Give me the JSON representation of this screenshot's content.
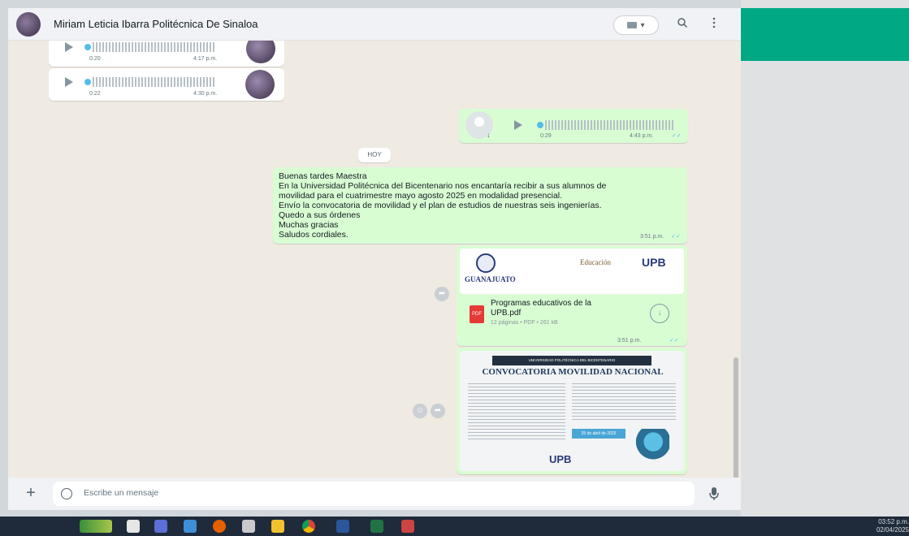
{
  "header": {
    "contact_name": "Miriam Leticia Ibarra Politécnica De Sinaloa",
    "video_label": "▾",
    "search_icon": "search-icon",
    "menu_icon": "kebab-menu-icon"
  },
  "messages": {
    "voice_in_1": {
      "duration": "0:20",
      "time": "4:17 p.m."
    },
    "voice_in_2": {
      "duration": "0:22",
      "time": "4:30 p.m."
    },
    "voice_out_1": {
      "duration": "0:29",
      "time": "4:43 p.m."
    },
    "day_separator": "HOY",
    "text_out": {
      "body": "Buenas tardes Maestra\nEn la Universidad Politécnica del Bicentenario nos encantaría recibir a sus alumnos de\nmovilidad para el cuatrimestre mayo agosto 2025 en modalidad presencial.\n Envío la convocatoria de movilidad y el plan de estudios de nuestras seis ingenierías.\nQuedo a sus órdenes\nMuchas gracias\nSaludos cordiales.",
      "time": "3:51 p.m."
    },
    "document_out": {
      "logo_left": "GUANAJUATO",
      "logo_mid": "Educación",
      "logo_right": "UPB",
      "pdf_badge": "PDF",
      "file_name": "Programas educativos de la UPB.pdf",
      "file_meta": "12 páginas • PDF • 261 kB",
      "time": "3:51 p.m."
    },
    "image_out": {
      "banner": "UNIVERSIDAD POLITÉCNICA DEL BICENTENARIO",
      "title": "CONVOCATORIA MOVILIDAD NACIONAL",
      "date_badge": "25 de abril de 2025",
      "footer_logo": "UPB"
    }
  },
  "composer": {
    "placeholder": "Escribe un mensaje"
  },
  "taskbar": {
    "time": "03:52 p.m.",
    "date": "02/04/2025"
  },
  "colors": {
    "accent_green": "#00a884",
    "outgoing_bubble": "#d9fdd3",
    "chat_bg": "#efeae2",
    "read_tick": "#53bdeb"
  }
}
